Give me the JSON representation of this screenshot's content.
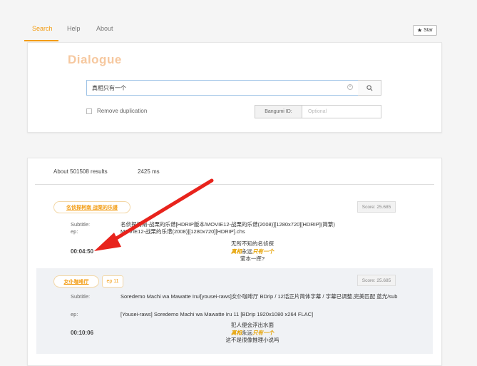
{
  "nav": {
    "tabs": [
      {
        "label": "Search",
        "active": true
      },
      {
        "label": "Help",
        "active": false
      },
      {
        "label": "About",
        "active": false
      }
    ],
    "star_label": "Star",
    "star_icon": "star-icon"
  },
  "search": {
    "brand": "Dialogue",
    "query": "真相只有一个",
    "clear_icon": "clear-circle-icon",
    "search_icon": "search-icon",
    "remove_duplication_label": "Remove duplication",
    "remove_duplication_checked": false,
    "bangumi_label": "Bangumi ID:",
    "bangumi_placeholder": "Optional"
  },
  "results": {
    "count_text": "About 501508 results",
    "time_text": "2425 ms",
    "items": [
      {
        "title": "名侦探柯南 战栗的乐谱",
        "episode": "",
        "score": "Score: 25.685",
        "subtitle_label": "Subtitle:",
        "subtitle_value": "名侦探柯南-战栗的乐谱[HDRIP版本/MOVIE12-战栗的乐谱(2008)][1280x720][HDRIP](简繁)",
        "ep_label": "ep:",
        "ep_value": "MOVIE12-战栗的乐谱(2008)][1280x720][HDRIP].chs",
        "time": "00:04:50",
        "dialogue_before": "无所不知的名侦探",
        "dialogue_hl_a": "真相",
        "dialogue_mid": "永远",
        "dialogue_hl_b": "只有一个",
        "dialogue_after": "莹本一挥?"
      },
      {
        "title": "女仆咖啡厅",
        "episode": "ep 11",
        "score": "Score: 25.685",
        "subtitle_label": "Subtitle:",
        "subtitle_value": "Soredemo Machi wa Mawatte Iru/[yousei-raws]女仆咖啡厅 BDrip / 12话正片简体字幕 / 字幕已调整,完美匹配 蓝光/sub",
        "ep_label": "ep:",
        "ep_value": "[Yousei-raws] Soredemo Machi wa Mawatte Iru 11 [BDrip 1920x1080 x264 FLAC]",
        "time": "00:10:06",
        "dialogue_before": "犯人便会浮出水面",
        "dialogue_hl_a": "真相",
        "dialogue_mid": "永远",
        "dialogue_hl_b": "只有一个",
        "dialogue_after": "这不是很像推理小说吗"
      }
    ]
  },
  "annotation": {
    "color": "#e8231c"
  }
}
